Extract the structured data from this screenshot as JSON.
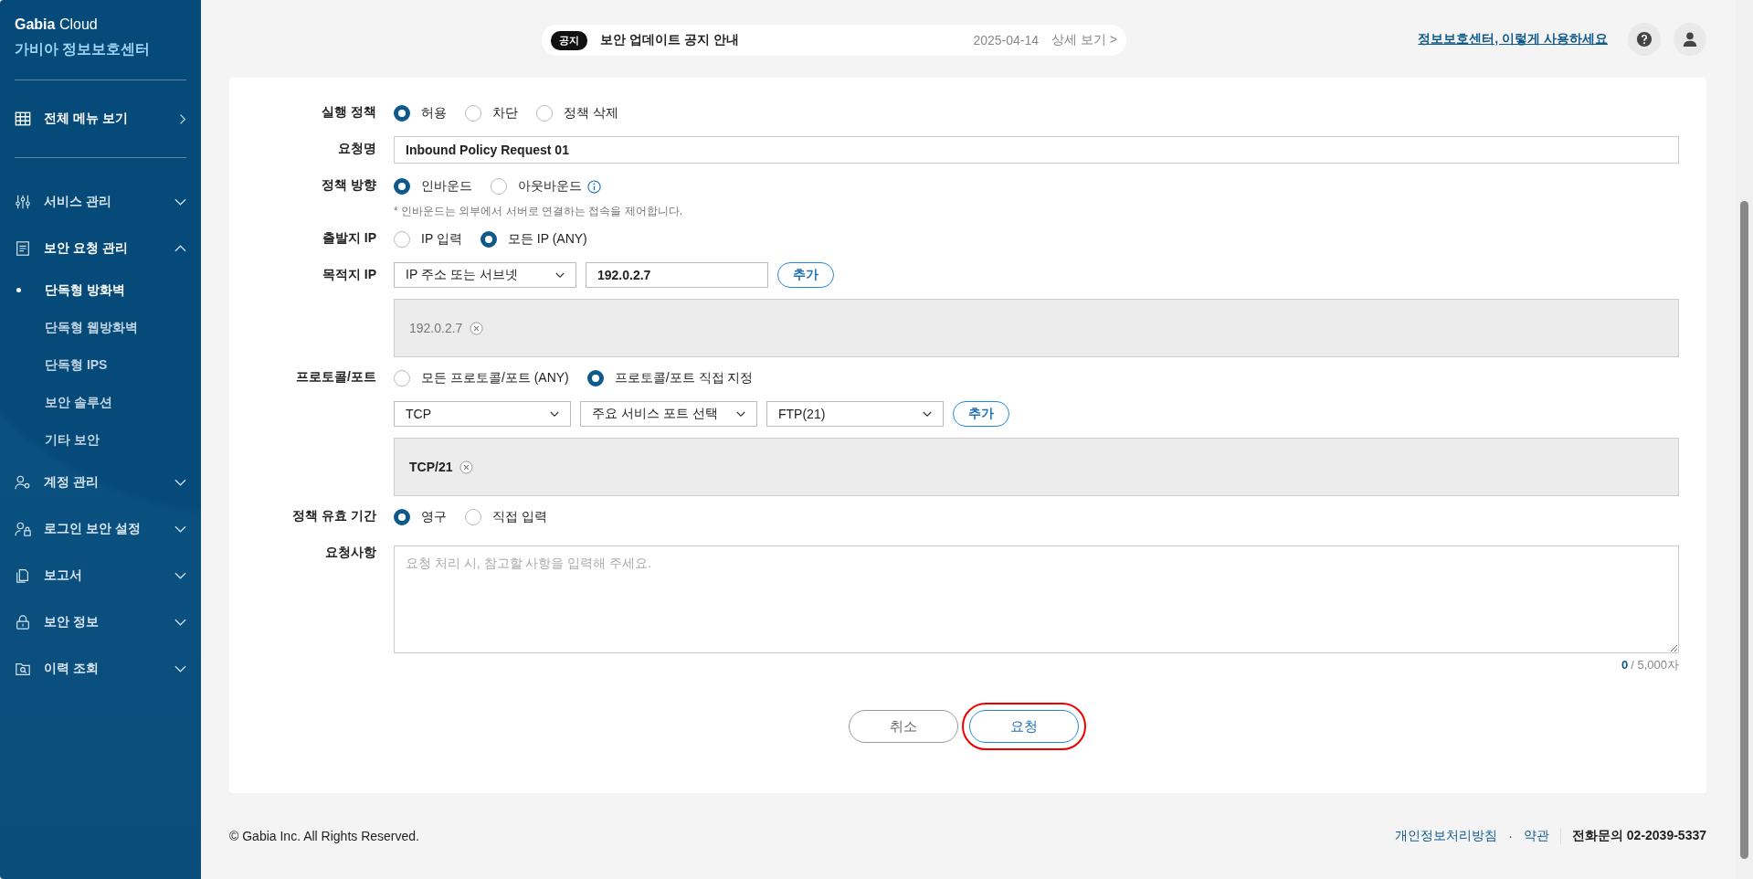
{
  "sidebar": {
    "brand": {
      "bold": "Gabia",
      "light": "Cloud"
    },
    "title": "가비아 정보보호센터",
    "all_menu": "전체 메뉴 보기",
    "menu": [
      {
        "label": "서비스 관리",
        "expanded": false
      },
      {
        "label": "보안 요청 관리",
        "expanded": true,
        "children": [
          {
            "label": "단독형 방화벽",
            "selected": true
          },
          {
            "label": "단독형 웹방화벽",
            "selected": false
          },
          {
            "label": "단독형 IPS",
            "selected": false
          },
          {
            "label": "보안 솔루션",
            "selected": false
          },
          {
            "label": "기타 보안",
            "selected": false
          }
        ]
      },
      {
        "label": "계정 관리",
        "expanded": false
      },
      {
        "label": "로그인 보안 설정",
        "expanded": false
      },
      {
        "label": "보고서",
        "expanded": false
      },
      {
        "label": "보안 정보",
        "expanded": false
      },
      {
        "label": "이력 조회",
        "expanded": false
      }
    ]
  },
  "notice": {
    "badge": "공지",
    "text": "보안 업데이트 공지 안내",
    "date": "2025-04-14",
    "link": "상세 보기 >"
  },
  "header": {
    "help_link": "정보보호센터, 이렇게 사용하세요"
  },
  "form": {
    "rows": [
      {
        "kind": "radio",
        "label": "실행 정책",
        "options": [
          {
            "label": "허용",
            "selected": true
          },
          {
            "label": "차단",
            "selected": false
          },
          {
            "label": "정책 삭제",
            "selected": false
          }
        ]
      },
      {
        "kind": "text",
        "label": "요청명",
        "value": "Inbound Policy Request 01"
      },
      {
        "kind": "radio",
        "label": "정책 방향",
        "options": [
          {
            "label": "인바운드",
            "selected": true
          },
          {
            "label": "아웃바운드",
            "selected": false,
            "info": true
          }
        ]
      },
      {
        "kind": "note",
        "text": "* 인바운드는 외부에서 서버로 연결하는 접속을 제어합니다."
      },
      {
        "kind": "radio",
        "label": "출발지 IP",
        "options": [
          {
            "label": "IP 입력",
            "selected": false
          },
          {
            "label": "모든 IP (ANY)",
            "selected": true
          }
        ]
      },
      {
        "kind": "picker",
        "label": "목적지 IP",
        "selects": [
          "IP 주소 또는 서브넷"
        ],
        "input": "192.0.2.7",
        "add": "추가",
        "chips": [
          {
            "text": "192.0.2.7",
            "muted": true
          }
        ]
      },
      {
        "kind": "radio",
        "label": "프로토콜/포트",
        "options": [
          {
            "label": "모든 프로토콜/포트 (ANY)",
            "selected": false
          },
          {
            "label": "프로토콜/포트 직접 지정",
            "selected": true
          }
        ]
      },
      {
        "kind": "picker",
        "selects": [
          "TCP",
          "주요 서비스 포트 선택",
          "FTP(21)"
        ],
        "add": "추가",
        "chips": [
          {
            "text": "TCP/21",
            "muted": false
          }
        ]
      },
      {
        "kind": "radio",
        "label": "정책 유효 기간",
        "options": [
          {
            "label": "영구",
            "selected": true
          },
          {
            "label": "직접 입력",
            "selected": false
          }
        ]
      },
      {
        "kind": "textarea",
        "label": "요청사항",
        "placeholder": "요청 처리 시, 참고할 사항을 입력해 주세요.",
        "count": "0",
        "max": "/ 5,000자"
      }
    ],
    "buttons": [
      {
        "label": "취소",
        "kind": "cancel",
        "highlighted": false
      },
      {
        "label": "요청",
        "kind": "submit",
        "highlighted": true
      }
    ]
  },
  "footer": {
    "copyright": "© Gabia Inc. All Rights Reserved.",
    "links": [
      "개인정보처리방침",
      "약관"
    ],
    "separator": "·",
    "phone": "전화문의 02-2039-5337"
  }
}
